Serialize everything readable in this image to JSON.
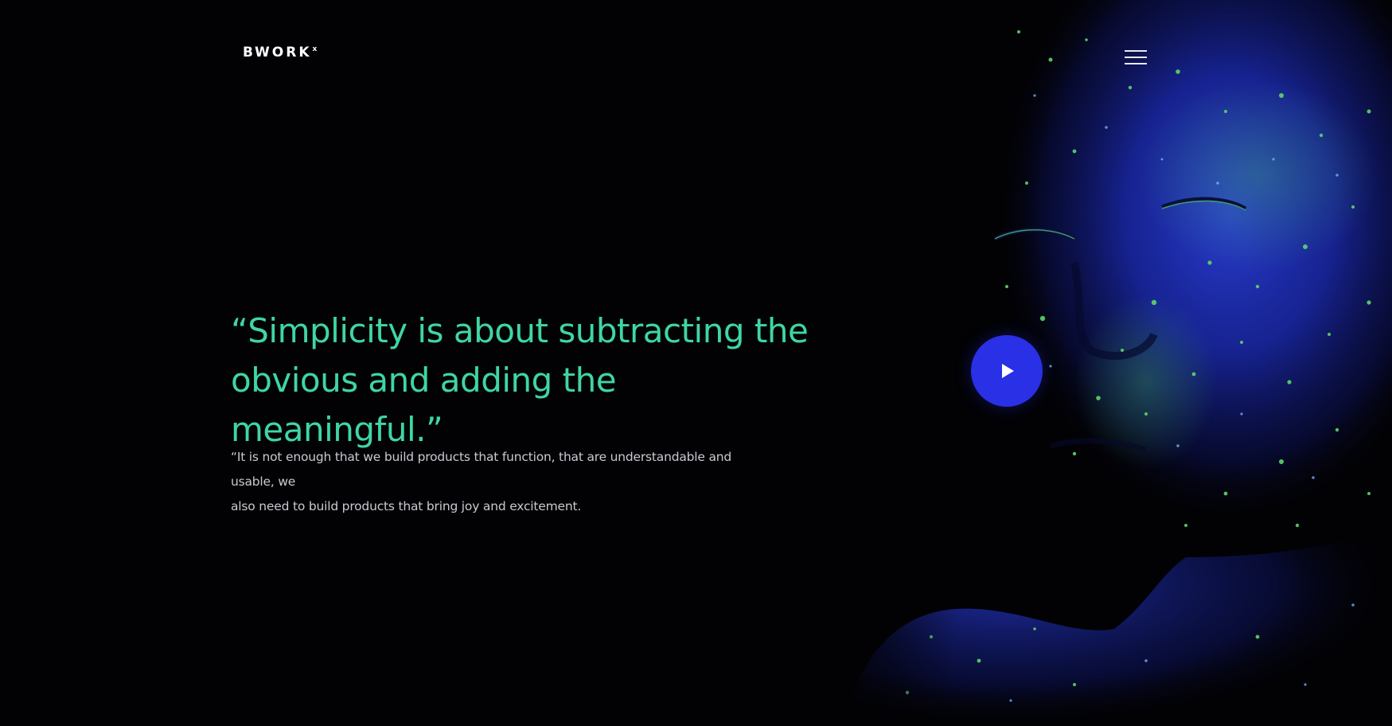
{
  "header": {
    "logo_text": "BWORK",
    "logo_mark": "x",
    "menu_icon": "hamburger-menu-icon"
  },
  "hero": {
    "quote_line_1": "“Simplicity is about subtracting the",
    "quote_line_2": "obvious and adding the meaningful.”",
    "body_line_1": "“It is not enough that we build products that function, that are understandable and usable, we",
    "body_line_2": "also need to build products that bring joy and excitement.",
    "play_icon": "play-icon",
    "image": "neon-painted-face-image"
  },
  "colors": {
    "background": "#020205",
    "accent_green": "#3fd6a2",
    "play_button": "#2a30e6",
    "body_text": "#c9c9d2"
  }
}
